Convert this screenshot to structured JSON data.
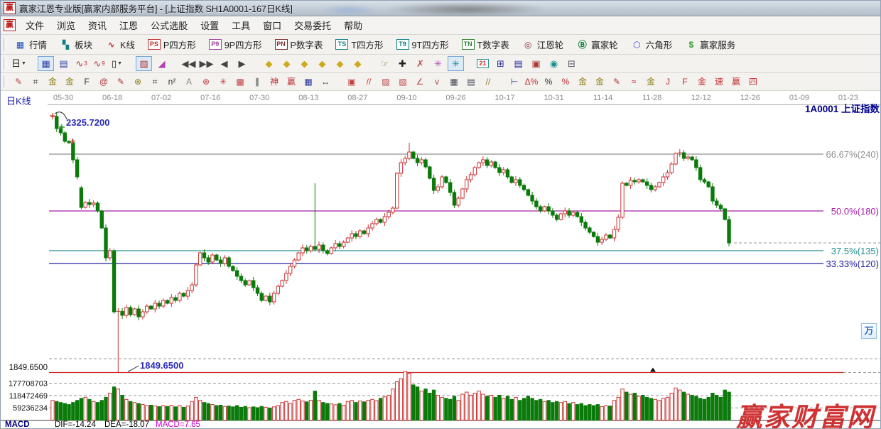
{
  "window": {
    "logo_char": "赢",
    "title": "赢家江恩专业版[赢家内部服务平台] - [上证指数  SH1A0001-167日K线]"
  },
  "menu": {
    "logo_char": "赢",
    "items": [
      "文件",
      "浏览",
      "资讯",
      "江恩",
      "公式选股",
      "设置",
      "工具",
      "窗口",
      "交易委托",
      "帮助"
    ]
  },
  "toolbar_features": [
    {
      "name": "quotes",
      "icon": "▦",
      "color": "#2050c0",
      "label": "行情"
    },
    {
      "name": "sectors",
      "icon": "▚",
      "color": "#108080",
      "label": "板块"
    },
    {
      "name": "kline",
      "icon": "∿",
      "color": "#c03030",
      "label": "K线"
    },
    {
      "name": "p-square",
      "icon": "PS",
      "color": "#c03030",
      "label": "P四方形",
      "boxed": true
    },
    {
      "name": "9p-square",
      "icon": "P9",
      "color": "#a040a0",
      "label": "9P四方形",
      "boxed": true
    },
    {
      "name": "p-number-table",
      "icon": "PN",
      "color": "#803030",
      "label": "P数字表",
      "boxed": true
    },
    {
      "name": "t-square",
      "icon": "TS",
      "color": "#108080",
      "label": "T四方形",
      "boxed": true
    },
    {
      "name": "9t-square",
      "icon": "T9",
      "color": "#108080",
      "label": "9T四方形",
      "boxed": true
    },
    {
      "name": "t-number-table",
      "icon": "TN",
      "color": "#308030",
      "label": "T数字表",
      "boxed": true
    },
    {
      "name": "gann-wheel",
      "icon": "◎",
      "color": "#903030",
      "label": "江恩轮"
    },
    {
      "name": "winner-wheel",
      "icon": "Ⓑ",
      "color": "#108040",
      "label": "赢家轮"
    },
    {
      "name": "hexagon",
      "icon": "⬡",
      "color": "#4040c0",
      "label": "六角形"
    },
    {
      "name": "winner-service",
      "icon": "$",
      "color": "#30a030",
      "label": "赢家服务"
    }
  ],
  "toolbar_main": [
    {
      "name": "period-day-dropdown",
      "g": "日",
      "c": "#222",
      "dd": true
    },
    {
      "sep": true
    },
    {
      "name": "chart-layout",
      "g": "▦",
      "c": "#3a49a8",
      "sel": true
    },
    {
      "name": "info-panel",
      "g": "▤",
      "c": "#3a49a8"
    },
    {
      "name": "kline-3",
      "g": "∿",
      "sub": "3",
      "c": "#b03535"
    },
    {
      "name": "kline-9",
      "g": "∿",
      "sub": "9",
      "c": "#b03535"
    },
    {
      "name": "candle-style-dropdown",
      "g": "▯",
      "c": "#222",
      "dd": true
    },
    {
      "sep": true
    },
    {
      "name": "pattern-mode",
      "g": "▨",
      "c": "#b03535",
      "sel": true
    },
    {
      "name": "color-histogram",
      "g": "◢",
      "c": "#b040b0"
    },
    {
      "sep": true
    },
    {
      "name": "jump-first",
      "g": "◀◀",
      "c": "#444"
    },
    {
      "name": "jump-last",
      "g": "▶▶",
      "c": "#444"
    },
    {
      "name": "prev-bar",
      "g": "◀",
      "c": "#444"
    },
    {
      "name": "next-bar",
      "g": "▶",
      "c": "#444"
    },
    {
      "sep": true
    },
    {
      "name": "gann-diamond-1",
      "g": "◆",
      "c": "#cfa91c"
    },
    {
      "name": "gann-diamond-2",
      "g": "◆",
      "c": "#cfa91c"
    },
    {
      "name": "gann-diamond-3",
      "g": "◆",
      "c": "#cfa91c"
    },
    {
      "name": "gann-diamond-4",
      "g": "◆",
      "c": "#cfa91c"
    },
    {
      "name": "gann-diamond-5",
      "g": "◆",
      "c": "#cfa91c"
    },
    {
      "name": "gann-diamond-6",
      "g": "◆",
      "c": "#cfa91c"
    },
    {
      "sep": true
    },
    {
      "name": "drag-hand",
      "g": "☞",
      "c": "#a8761d"
    },
    {
      "name": "crosshair",
      "g": "✚",
      "c": "#222"
    },
    {
      "name": "eraser",
      "g": "✗",
      "c": "#c05050"
    },
    {
      "name": "flower-tool",
      "g": "✳",
      "c": "#b545b5"
    },
    {
      "name": "brain-tool",
      "g": "✳",
      "c": "#1d8f8f",
      "sel": true
    },
    {
      "sep": true
    },
    {
      "name": "calendar",
      "g": "21",
      "c": "#c03030",
      "box": true
    },
    {
      "name": "calculator",
      "g": "⊞",
      "c": "#28329a"
    },
    {
      "name": "notes",
      "g": "▤",
      "c": "#28329a"
    },
    {
      "name": "save",
      "g": "▣",
      "c": "#b03535"
    },
    {
      "name": "web-link",
      "g": "◉",
      "c": "#1d8f8f"
    },
    {
      "name": "print",
      "g": "⊟",
      "c": "#555566"
    }
  ],
  "toolbar_draw": [
    {
      "name": "pencil",
      "g": "✎",
      "c": "#c04040"
    },
    {
      "name": "grid-hatch",
      "g": "⌗",
      "c": "#333333"
    },
    {
      "name": "gold-level-1",
      "g": "金",
      "c": "#8a7a10"
    },
    {
      "name": "gold-level-2",
      "g": "金",
      "c": "#8a7a10"
    },
    {
      "name": "fibonacci",
      "g": "F",
      "c": "#333333"
    },
    {
      "name": "spiral",
      "g": "@",
      "c": "#b03535"
    },
    {
      "name": "pencil-2",
      "g": "✎",
      "c": "#b03535"
    },
    {
      "name": "circle-gold",
      "g": "⊕",
      "c": "#8a7a10"
    },
    {
      "name": "grid-hatch-2",
      "g": "⌗",
      "c": "#333333"
    },
    {
      "name": "n-square",
      "g": "n²",
      "c": "#333333"
    },
    {
      "name": "angle-a",
      "g": "A",
      "c": "#888888"
    },
    {
      "name": "gann-circle",
      "g": "⊕",
      "c": "#c04040"
    },
    {
      "name": "gann-web",
      "g": "✳",
      "c": "#c04040"
    },
    {
      "name": "gann-box-web",
      "g": "▩",
      "c": "#c04040"
    },
    {
      "name": "tick-marks",
      "g": "∥",
      "c": "#333333"
    },
    {
      "name": "shen-tool",
      "g": "神",
      "c": "#c03030"
    },
    {
      "name": "ying-tool",
      "g": "赢",
      "c": "#c03030"
    },
    {
      "name": "grid-123",
      "g": "▦",
      "c": "#28329a"
    },
    {
      "name": "width-arrows",
      "g": "↔",
      "c": "#333333"
    },
    {
      "sep": true
    },
    {
      "name": "box-tool",
      "g": "▣",
      "c": "#c04040"
    },
    {
      "name": "fan-lines",
      "g": "//",
      "c": "#c04040"
    },
    {
      "name": "hatch-box-1",
      "g": "▨",
      "c": "#c04040"
    },
    {
      "name": "hatch-box-2",
      "g": "▧",
      "c": "#c04040"
    },
    {
      "name": "angle-line",
      "g": "∠",
      "c": "#c04040"
    },
    {
      "name": "wave-check",
      "g": "v",
      "c": "#c04040"
    },
    {
      "name": "grid-dark",
      "g": "▦",
      "c": "#444455"
    },
    {
      "name": "list-dark",
      "g": "▤",
      "c": "#444455"
    },
    {
      "name": "parallel-lines",
      "g": "//",
      "c": "#8a7a10"
    },
    {
      "sep": true
    },
    {
      "name": "ruler",
      "g": "⊢",
      "c": "#28329a"
    },
    {
      "name": "delta-percent",
      "g": "Δ%",
      "c": "#c03030"
    },
    {
      "name": "percent",
      "g": "%",
      "c": "#333333"
    },
    {
      "name": "percent-line",
      "g": "%",
      "c": "#c03030"
    },
    {
      "name": "gold-circle",
      "g": "金",
      "c": "#8a7a10"
    },
    {
      "name": "gold-lines",
      "g": "金",
      "c": "#8a7a10"
    },
    {
      "name": "brush",
      "g": "✎",
      "c": "#b03535"
    },
    {
      "name": "wave-gold",
      "g": "≈",
      "c": "#c03030"
    },
    {
      "name": "gold-underline",
      "g": "金",
      "c": "#8a7a10"
    },
    {
      "name": "angle-j",
      "g": "J",
      "c": "#c03030"
    },
    {
      "name": "angle-f",
      "g": "F",
      "c": "#c03030"
    },
    {
      "name": "angle-gold",
      "g": "金",
      "c": "#c03030"
    },
    {
      "name": "angle-su",
      "g": "速",
      "c": "#c03030"
    },
    {
      "name": "angle-ying",
      "g": "赢",
      "c": "#c03030"
    },
    {
      "name": "angle-si",
      "g": "四",
      "c": "#c03030"
    }
  ],
  "chart": {
    "period_label": "日K线",
    "symbol_label": "1A0001  上证指数",
    "high_label": "2325.7200",
    "low_label": "1849.6500",
    "low_axis_label": "1849.6500",
    "watermark": "赢家财富网",
    "float_button": "万"
  },
  "status": {
    "indicator": "MACD",
    "dif": "DIF=-14.24",
    "dea": "DEA=-18.07",
    "macd": "MACD=7.65"
  },
  "chart_data": {
    "type": "candlestick",
    "title": "上证指数 SH1A0001 167日K线",
    "symbol": "SH1A0001",
    "name": "上证指数",
    "visible_high": 2325.72,
    "visible_low": 1849.65,
    "x_axis_dates": [
      "05-30",
      "06-18",
      "07-02",
      "07-16",
      "07-30",
      "08-13",
      "08-27",
      "09-10",
      "09-26",
      "10-17",
      "10-31",
      "11-14",
      "11-28",
      "12-12",
      "12-26",
      "01-09",
      "01-23"
    ],
    "gann_levels": [
      {
        "label": "66.67%(240)",
        "color": "#8f8f8f",
        "price": 2252.3
      },
      {
        "label": "50.0%(180)",
        "color": "#a520a5",
        "price": 2147.4
      },
      {
        "label": "37.5%(135)",
        "color": "#1e8e8e",
        "price": 2074.0
      },
      {
        "label": "33.33%(120)",
        "color": "#2222a0",
        "price": 2050.3
      }
    ],
    "open_rule": "previous_close",
    "closes": [
      2321.8,
      2299.5,
      2291.6,
      2275.9,
      2273.3,
      2241.8,
      2210.3,
      2153.9,
      2163.1,
      2159.2,
      2161.8,
      2147.4,
      2115.9,
      2060.8,
      2073.9,
      1961.1,
      1962.0,
      1954.6,
      1969.0,
      1955.9,
      1966.4,
      1951.9,
      1961.1,
      1971.6,
      1966.4,
      1976.9,
      1971.6,
      1982.1,
      1976.9,
      1987.3,
      1982.1,
      1995.2,
      1990.0,
      2000.4,
      2010.9,
      2047.7,
      2070.0,
      2060.8,
      2052.9,
      2066.0,
      2056.8,
      2050.3,
      2060.8,
      2045.1,
      2037.2,
      2026.7,
      2018.8,
      2010.9,
      2018.8,
      2005.7,
      1995.2,
      1982.1,
      1990.0,
      1979.5,
      1995.2,
      2008.3,
      2018.8,
      2032.0,
      2045.1,
      2056.8,
      2069.9,
      2079.2,
      2073.9,
      2081.8,
      2076.5,
      2084.4,
      2073.9,
      2068.7,
      2079.2,
      2087.0,
      2081.8,
      2089.6,
      2097.5,
      2105.4,
      2100.1,
      2110.6,
      2105.4,
      2115.9,
      2123.8,
      2131.6,
      2126.4,
      2136.9,
      2144.8,
      2152.6,
      2216.9,
      2236.5,
      2244.4,
      2256.2,
      2244.4,
      2236.5,
      2241.8,
      2228.7,
      2207.7,
      2185.4,
      2192.0,
      2210.3,
      2199.8,
      2181.5,
      2157.9,
      2171.0,
      2188.0,
      2205.1,
      2214.3,
      2227.4,
      2236.5,
      2241.8,
      2231.3,
      2237.8,
      2227.4,
      2218.2,
      2223.4,
      2210.3,
      2199.8,
      2205.1,
      2194.6,
      2186.7,
      2176.2,
      2165.7,
      2155.2,
      2147.4,
      2155.2,
      2147.4,
      2139.5,
      2131.6,
      2142.1,
      2147.4,
      2139.5,
      2144.8,
      2136.9,
      2126.4,
      2115.9,
      2108.0,
      2100.1,
      2089.6,
      2094.9,
      2102.8,
      2097.5,
      2113.3,
      2135.6,
      2198.5,
      2194.6,
      2203.8,
      2201.1,
      2205.1,
      2201.1,
      2194.6,
      2186.7,
      2192.0,
      2199.8,
      2210.3,
      2218.2,
      2233.9,
      2253.6,
      2254.9,
      2244.4,
      2247.0,
      2241.8,
      2227.4,
      2205.1,
      2201.1,
      2192.0,
      2165.7,
      2157.9,
      2151.3,
      2131.6,
      2088.3
    ],
    "special_bars": {
      "0": {
        "high": 2325.72,
        "low": 2316.0
      },
      "7": {
        "open": 2190.0
      },
      "16": {
        "low": 1849.65,
        "high": 1968.0
      },
      "64": {
        "high": 2198.5
      },
      "87": {
        "high": 2273.3
      }
    },
    "volumes_millions": [
      95,
      90,
      85,
      80,
      75,
      85,
      95,
      105,
      110,
      100,
      90,
      85,
      95,
      110,
      130,
      160,
      150,
      120,
      100,
      90,
      85,
      80,
      75,
      70,
      72,
      68,
      65,
      70,
      66,
      72,
      64,
      70,
      62,
      68,
      90,
      110,
      95,
      85,
      80,
      75,
      70,
      72,
      66,
      68,
      64,
      70,
      62,
      66,
      60,
      64,
      60,
      66,
      62,
      58,
      64,
      70,
      85,
      90,
      80,
      95,
      100,
      92,
      88,
      96,
      140,
      95,
      85,
      80,
      78,
      74,
      80,
      72,
      90,
      95,
      85,
      92,
      88,
      96,
      100,
      94,
      105,
      112,
      120,
      150,
      185,
      200,
      235,
      225,
      170,
      160,
      140,
      150,
      130,
      145,
      120,
      110,
      105,
      100,
      115,
      95,
      125,
      135,
      120,
      130,
      140,
      125,
      115,
      120,
      110,
      120,
      105,
      115,
      100,
      110,
      95,
      105,
      115,
      105,
      95,
      100,
      90,
      95,
      85,
      90,
      85,
      90,
      80,
      85,
      75,
      80,
      70,
      75,
      70,
      75,
      65,
      70,
      68,
      95,
      110,
      150,
      135,
      125,
      130,
      115,
      120,
      110,
      105,
      100,
      95,
      105,
      110,
      130,
      155,
      145,
      135,
      125,
      120,
      115,
      105,
      100,
      110,
      130,
      120,
      110,
      145,
      135
    ],
    "volume_axis_ticks": [
      "177708703",
      "118472469",
      "59236234"
    ],
    "last_close_dashed_level": 2088.3,
    "low_line_level": 1849.65,
    "colors": {
      "up": "#cc3333",
      "down": "#0b7a0b",
      "low_line": "#cc2222",
      "grid_dash": "#9a9a9a",
      "axis_text": "#8a8a8a"
    }
  }
}
